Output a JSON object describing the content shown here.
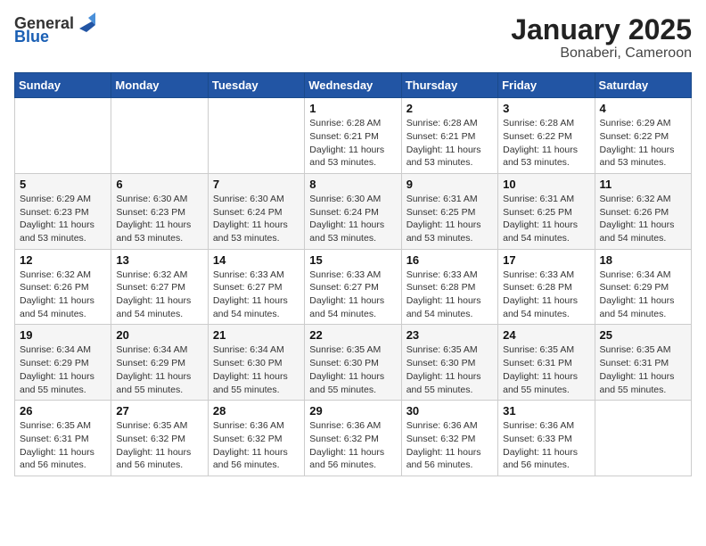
{
  "header": {
    "logo_general": "General",
    "logo_blue": "Blue",
    "title": "January 2025",
    "subtitle": "Bonaberi, Cameroon"
  },
  "weekdays": [
    "Sunday",
    "Monday",
    "Tuesday",
    "Wednesday",
    "Thursday",
    "Friday",
    "Saturday"
  ],
  "weeks": [
    [
      {
        "day": "",
        "info": ""
      },
      {
        "day": "",
        "info": ""
      },
      {
        "day": "",
        "info": ""
      },
      {
        "day": "1",
        "info": "Sunrise: 6:28 AM\nSunset: 6:21 PM\nDaylight: 11 hours\nand 53 minutes."
      },
      {
        "day": "2",
        "info": "Sunrise: 6:28 AM\nSunset: 6:21 PM\nDaylight: 11 hours\nand 53 minutes."
      },
      {
        "day": "3",
        "info": "Sunrise: 6:28 AM\nSunset: 6:22 PM\nDaylight: 11 hours\nand 53 minutes."
      },
      {
        "day": "4",
        "info": "Sunrise: 6:29 AM\nSunset: 6:22 PM\nDaylight: 11 hours\nand 53 minutes."
      }
    ],
    [
      {
        "day": "5",
        "info": "Sunrise: 6:29 AM\nSunset: 6:23 PM\nDaylight: 11 hours\nand 53 minutes."
      },
      {
        "day": "6",
        "info": "Sunrise: 6:30 AM\nSunset: 6:23 PM\nDaylight: 11 hours\nand 53 minutes."
      },
      {
        "day": "7",
        "info": "Sunrise: 6:30 AM\nSunset: 6:24 PM\nDaylight: 11 hours\nand 53 minutes."
      },
      {
        "day": "8",
        "info": "Sunrise: 6:30 AM\nSunset: 6:24 PM\nDaylight: 11 hours\nand 53 minutes."
      },
      {
        "day": "9",
        "info": "Sunrise: 6:31 AM\nSunset: 6:25 PM\nDaylight: 11 hours\nand 53 minutes."
      },
      {
        "day": "10",
        "info": "Sunrise: 6:31 AM\nSunset: 6:25 PM\nDaylight: 11 hours\nand 54 minutes."
      },
      {
        "day": "11",
        "info": "Sunrise: 6:32 AM\nSunset: 6:26 PM\nDaylight: 11 hours\nand 54 minutes."
      }
    ],
    [
      {
        "day": "12",
        "info": "Sunrise: 6:32 AM\nSunset: 6:26 PM\nDaylight: 11 hours\nand 54 minutes."
      },
      {
        "day": "13",
        "info": "Sunrise: 6:32 AM\nSunset: 6:27 PM\nDaylight: 11 hours\nand 54 minutes."
      },
      {
        "day": "14",
        "info": "Sunrise: 6:33 AM\nSunset: 6:27 PM\nDaylight: 11 hours\nand 54 minutes."
      },
      {
        "day": "15",
        "info": "Sunrise: 6:33 AM\nSunset: 6:27 PM\nDaylight: 11 hours\nand 54 minutes."
      },
      {
        "day": "16",
        "info": "Sunrise: 6:33 AM\nSunset: 6:28 PM\nDaylight: 11 hours\nand 54 minutes."
      },
      {
        "day": "17",
        "info": "Sunrise: 6:33 AM\nSunset: 6:28 PM\nDaylight: 11 hours\nand 54 minutes."
      },
      {
        "day": "18",
        "info": "Sunrise: 6:34 AM\nSunset: 6:29 PM\nDaylight: 11 hours\nand 54 minutes."
      }
    ],
    [
      {
        "day": "19",
        "info": "Sunrise: 6:34 AM\nSunset: 6:29 PM\nDaylight: 11 hours\nand 55 minutes."
      },
      {
        "day": "20",
        "info": "Sunrise: 6:34 AM\nSunset: 6:29 PM\nDaylight: 11 hours\nand 55 minutes."
      },
      {
        "day": "21",
        "info": "Sunrise: 6:34 AM\nSunset: 6:30 PM\nDaylight: 11 hours\nand 55 minutes."
      },
      {
        "day": "22",
        "info": "Sunrise: 6:35 AM\nSunset: 6:30 PM\nDaylight: 11 hours\nand 55 minutes."
      },
      {
        "day": "23",
        "info": "Sunrise: 6:35 AM\nSunset: 6:30 PM\nDaylight: 11 hours\nand 55 minutes."
      },
      {
        "day": "24",
        "info": "Sunrise: 6:35 AM\nSunset: 6:31 PM\nDaylight: 11 hours\nand 55 minutes."
      },
      {
        "day": "25",
        "info": "Sunrise: 6:35 AM\nSunset: 6:31 PM\nDaylight: 11 hours\nand 55 minutes."
      }
    ],
    [
      {
        "day": "26",
        "info": "Sunrise: 6:35 AM\nSunset: 6:31 PM\nDaylight: 11 hours\nand 56 minutes."
      },
      {
        "day": "27",
        "info": "Sunrise: 6:35 AM\nSunset: 6:32 PM\nDaylight: 11 hours\nand 56 minutes."
      },
      {
        "day": "28",
        "info": "Sunrise: 6:36 AM\nSunset: 6:32 PM\nDaylight: 11 hours\nand 56 minutes."
      },
      {
        "day": "29",
        "info": "Sunrise: 6:36 AM\nSunset: 6:32 PM\nDaylight: 11 hours\nand 56 minutes."
      },
      {
        "day": "30",
        "info": "Sunrise: 6:36 AM\nSunset: 6:32 PM\nDaylight: 11 hours\nand 56 minutes."
      },
      {
        "day": "31",
        "info": "Sunrise: 6:36 AM\nSunset: 6:33 PM\nDaylight: 11 hours\nand 56 minutes."
      },
      {
        "day": "",
        "info": ""
      }
    ]
  ]
}
